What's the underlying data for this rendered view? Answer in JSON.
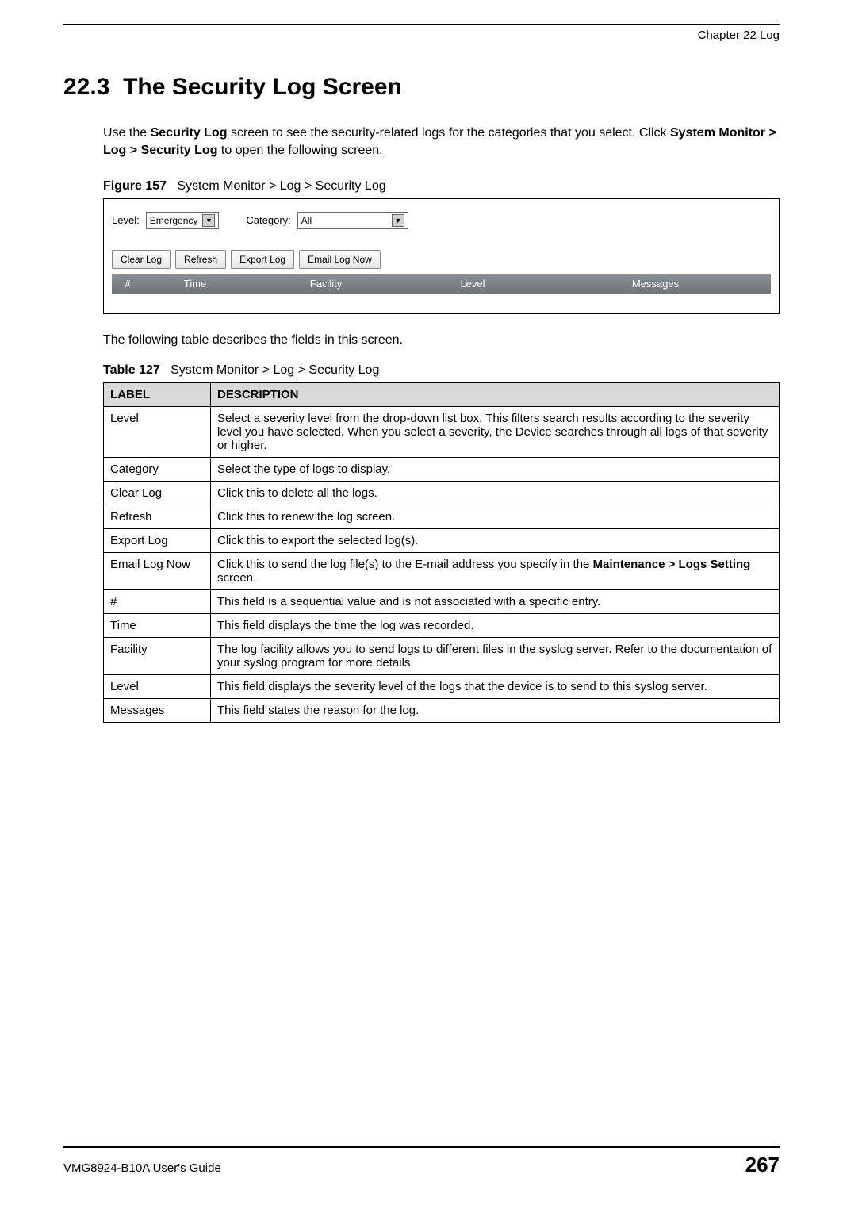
{
  "header": {
    "chapter": "Chapter 22 Log"
  },
  "section": {
    "number": "22.3",
    "title": "The Security Log Screen"
  },
  "intro": {
    "part1": "Use the ",
    "bold1": "Security Log",
    "part2": " screen to see the security-related logs for the categories that you select. Click ",
    "bold2": "System Monitor > Log > Security Log",
    "part3": " to open the following screen."
  },
  "figure": {
    "label": "Figure 157",
    "caption": "System Monitor > Log > Security Log",
    "level_label": "Level:",
    "level_value": "Emergency",
    "category_label": "Category:",
    "category_value": "All",
    "buttons": {
      "clear": "Clear Log",
      "refresh": "Refresh",
      "export": "Export Log",
      "email": "Email Log Now"
    },
    "columns": {
      "num": "#",
      "time": "Time",
      "facility": "Facility",
      "level": "Level",
      "messages": "Messages"
    }
  },
  "after_figure": "The following table describes the fields in this screen.",
  "table": {
    "label": "Table 127",
    "caption": "System Monitor > Log > Security Log",
    "headers": {
      "label": "LABEL",
      "description": "DESCRIPTION"
    },
    "rows": [
      {
        "label": "Level",
        "desc": "Select a severity level from the drop-down list box. This filters search results according to the severity level you have selected. When you select a severity, the Device searches through all logs of that severity or higher."
      },
      {
        "label": "Category",
        "desc": "Select the type of logs to display."
      },
      {
        "label": "Clear Log",
        "desc": "Click this to delete all the logs."
      },
      {
        "label": "Refresh",
        "desc": "Click this to renew the log screen."
      },
      {
        "label": "Export Log",
        "desc": "Click this to export the selected log(s)."
      },
      {
        "label": "Email Log Now",
        "desc_pre": "Click this to send the log file(s) to the E-mail address you specify in the ",
        "desc_bold": "Maintenance > Logs Setting",
        "desc_post": " screen."
      },
      {
        "label": "#",
        "desc": "This field is a sequential value and is not associated with a specific entry."
      },
      {
        "label": "Time",
        "desc": "This field displays the time the log was recorded."
      },
      {
        "label": "Facility",
        "desc": "The log facility allows you to send logs to different files in the syslog server. Refer to the documentation of your syslog program for more details."
      },
      {
        "label": "Level",
        "desc": "This field displays the severity level of the logs that the device is to send to this syslog server."
      },
      {
        "label": "Messages",
        "desc": "This field states the reason for the log."
      }
    ]
  },
  "footer": {
    "guide": "VMG8924-B10A User's Guide",
    "page": "267"
  }
}
